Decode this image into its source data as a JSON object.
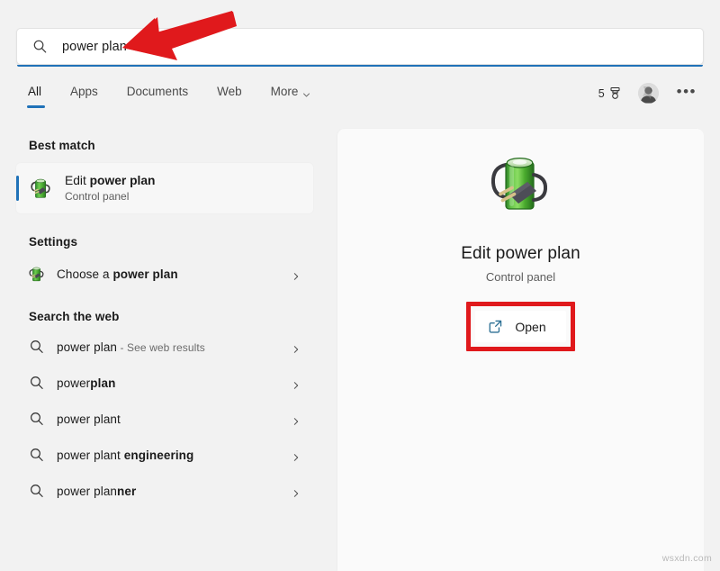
{
  "search": {
    "query": "power plan",
    "icon": "search-icon",
    "accent_color": "#2072b8"
  },
  "tabs": [
    {
      "label": "All",
      "active": true
    },
    {
      "label": "Apps",
      "active": false
    },
    {
      "label": "Documents",
      "active": false
    },
    {
      "label": "Web",
      "active": false
    },
    {
      "label": "More",
      "active": false,
      "icon": "chevron-down-icon"
    }
  ],
  "tabbar_right": {
    "rewards_count": "5",
    "rewards_icon": "medal-icon",
    "avatar": "user-avatar",
    "overflow": "•••"
  },
  "left_panel": {
    "sections": [
      {
        "title": "Best match"
      },
      {
        "title": "Settings"
      },
      {
        "title": "Search the web"
      }
    ],
    "best_match": {
      "title_prefix": "Edit ",
      "title_bold": "power plan",
      "subtitle": "Control panel",
      "icon": "power-plan-icon",
      "selected": true
    },
    "settings_items": [
      {
        "prefix": "Choose a ",
        "bold": "power plan",
        "suffix": "",
        "icon": "power-plan-icon",
        "chevron": "chevron-right-icon"
      }
    ],
    "web_items": [
      {
        "prefix": "power plan",
        "bold": "",
        "suffix": " - See web results",
        "icon": "search-icon",
        "chevron": "chevron-right-icon"
      },
      {
        "prefix": "power",
        "bold": "plan",
        "suffix": "",
        "icon": "search-icon",
        "chevron": "chevron-right-icon"
      },
      {
        "prefix": "power plant",
        "bold": "",
        "suffix": "",
        "icon": "search-icon",
        "chevron": "chevron-right-icon"
      },
      {
        "prefix": "power plant ",
        "bold": "engineering",
        "suffix": "",
        "icon": "search-icon",
        "chevron": "chevron-right-icon"
      },
      {
        "prefix": "power plan",
        "bold": "ner",
        "suffix": "",
        "icon": "search-icon",
        "chevron": "chevron-right-icon"
      }
    ]
  },
  "right_panel": {
    "icon": "power-plan-icon",
    "title": "Edit power plan",
    "subtitle": "Control panel",
    "open_button": {
      "label": "Open",
      "icon": "external-link-icon",
      "highlight_color": "#e0191c"
    }
  },
  "annotations": {
    "arrow_color": "#e0191c",
    "watermark": "wsxdn.com"
  }
}
